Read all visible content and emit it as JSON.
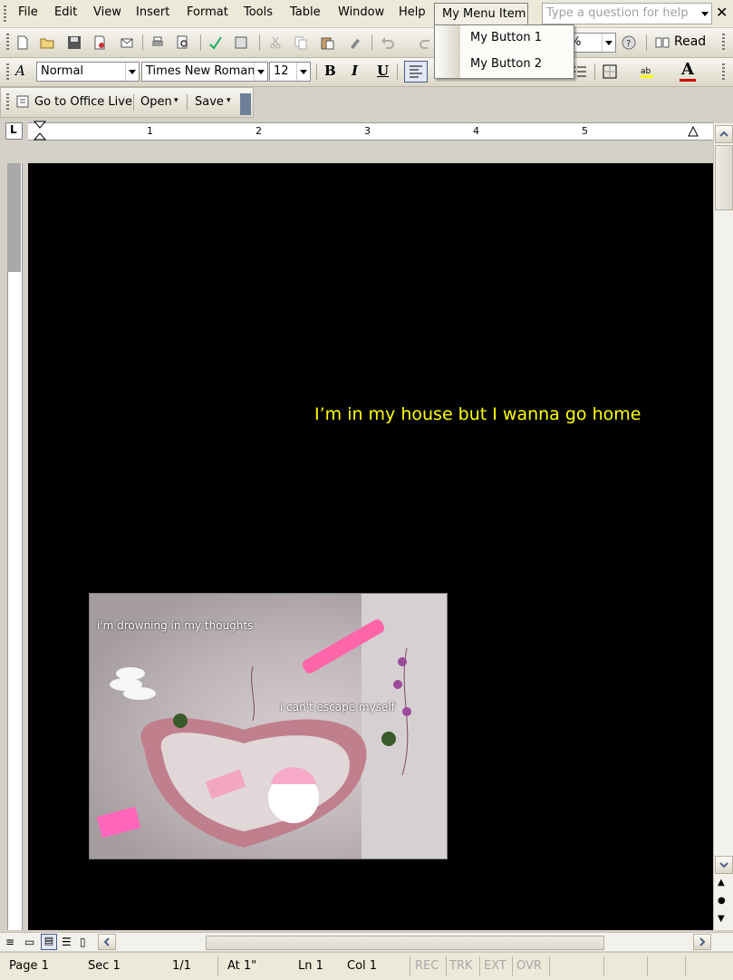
{
  "menubar": {
    "items": [
      {
        "label": "File"
      },
      {
        "label": "Edit"
      },
      {
        "label": "View"
      },
      {
        "label": "Insert"
      },
      {
        "label": "Format"
      },
      {
        "label": "Tools"
      },
      {
        "label": "Table"
      },
      {
        "label": "Window"
      },
      {
        "label": "Help"
      }
    ],
    "custom_menu": "My Menu Item",
    "help_placeholder": "Type a question for help",
    "close_glyph": "✕"
  },
  "dropdown": {
    "items": [
      "My Button 1",
      "My Button 2"
    ]
  },
  "standard_toolbar": {
    "zoom": "%",
    "read_label": "Read"
  },
  "formatting_toolbar": {
    "style": "Normal",
    "font": "Times New Roman",
    "size": "12",
    "bold": "B",
    "italic": "I",
    "underline": "U"
  },
  "office_toolbar": {
    "go_office": "Go to Office Live",
    "open": "Open",
    "save": "Save"
  },
  "ruler": {
    "numbers": [
      "1",
      "2",
      "3",
      "4",
      "5"
    ]
  },
  "document": {
    "background": "#000000",
    "text": "I’m in my house but I wanna go home",
    "text_color": "#ffff00",
    "image_captions": [
      "i'm drowning in my thoughts",
      "i can't escape myself"
    ]
  },
  "statusbar": {
    "page": "Page  1",
    "sec": "Sec  1",
    "pages": "1/1",
    "at": "At  1\"",
    "ln": "Ln  1",
    "col": "Col  1",
    "rec": "REC",
    "trk": "TRK",
    "ext": "EXT",
    "ovr": "OVR"
  }
}
